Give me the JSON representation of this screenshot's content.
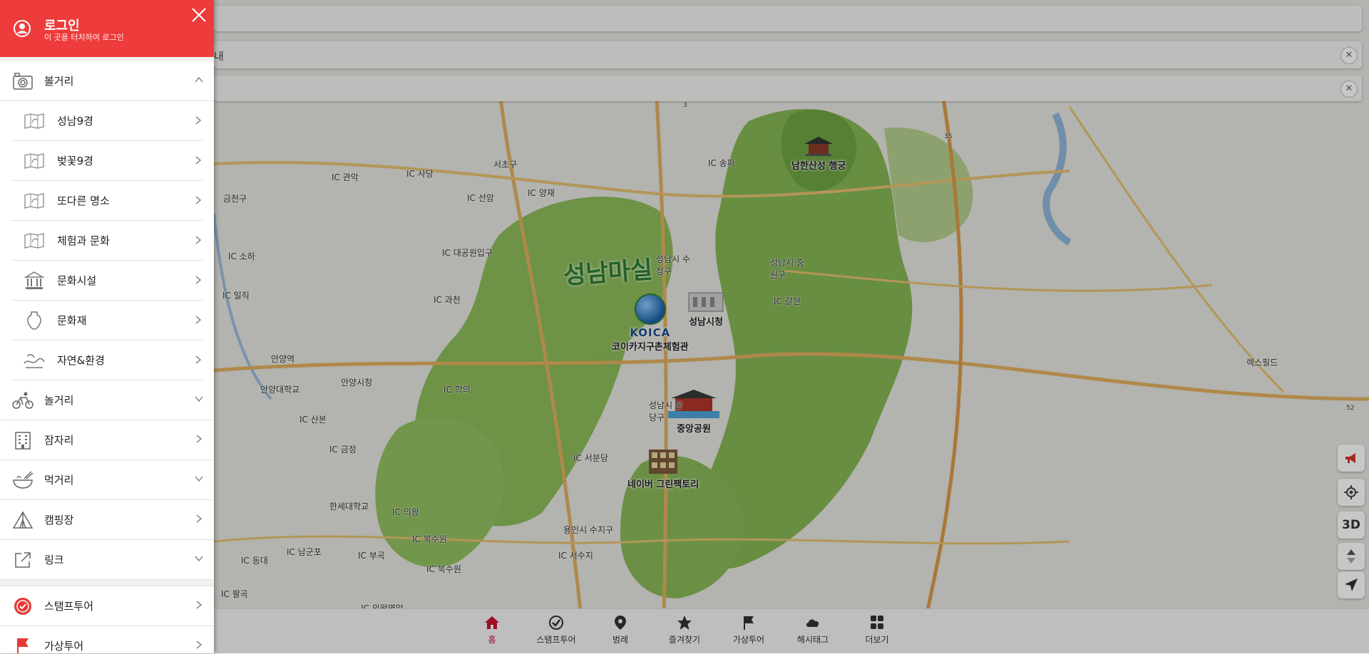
{
  "sidebar": {
    "login": {
      "title": "로그인",
      "subtitle": "이 곳을 터치하여 로그인"
    },
    "sights": {
      "label": "볼거리",
      "items": [
        {
          "label": "성남9경",
          "icon": "map-icon"
        },
        {
          "label": "벚꽃9경",
          "icon": "map-icon"
        },
        {
          "label": "또다른 명소",
          "icon": "map-icon"
        },
        {
          "label": "체험과 문화",
          "icon": "map-icon"
        },
        {
          "label": "문화시설",
          "icon": "museum-icon"
        },
        {
          "label": "문화재",
          "icon": "vase-icon"
        },
        {
          "label": "자연&환경",
          "icon": "nature-icon"
        }
      ]
    },
    "menu": [
      {
        "label": "놀거리",
        "icon": "bike-icon",
        "chevron": "down"
      },
      {
        "label": "잠자리",
        "icon": "hotel-icon",
        "chevron": "right"
      },
      {
        "label": "먹거리",
        "icon": "food-icon",
        "chevron": "down"
      },
      {
        "label": "캠핑장",
        "icon": "tent-icon",
        "chevron": "right"
      },
      {
        "label": "링크",
        "icon": "external-link-icon",
        "chevron": "down"
      }
    ],
    "extra": [
      {
        "label": "스탬프투어",
        "icon": "stamp-icon"
      },
      {
        "label": "가상투어",
        "icon": "flag-icon"
      }
    ]
  },
  "map": {
    "top_search_partial": "내",
    "logo_text": "성남마실",
    "koica_text": "KOICA",
    "pois": [
      {
        "name": "남한산성 행궁"
      },
      {
        "name": "성남시청"
      },
      {
        "name": "코이카지구촌체험관"
      },
      {
        "name": "중앙공원"
      },
      {
        "name": "네이버 그린팩토리"
      }
    ],
    "labels": [
      "서초구",
      "IC 관악",
      "IC 사당",
      "IC 선암",
      "IC 양재",
      "IC 송파",
      "금천구",
      "IC 소하",
      "IC 대공원입구",
      "IC 과천",
      "IC 일직",
      "안양역",
      "안양대학교",
      "안양시청",
      "IC 학의",
      "IC 산본",
      "IC 금정",
      "IC 서분당",
      "한세대학교",
      "IC 의왕",
      "IC 북수원",
      "IC 남군포",
      "IC 부곡",
      "IC 서수지",
      "IC 동대",
      "IC 북수원",
      "IC 팔곡",
      "IC 의왕영업",
      "IC 갈현",
      "성남시 중원구",
      "성남시 수정구",
      "성남시 분당구",
      "용인시 수지구",
      "렉스필드",
      "35",
      "52",
      "3"
    ],
    "three_d_label": "3D"
  },
  "bottom_nav": [
    {
      "label": "홈",
      "icon": "home-icon",
      "active": true
    },
    {
      "label": "스탬프투어",
      "icon": "stamp-check-icon",
      "active": false
    },
    {
      "label": "범례",
      "icon": "pin-icon",
      "active": false
    },
    {
      "label": "즐겨찾기",
      "icon": "star-icon",
      "active": false
    },
    {
      "label": "가상투어",
      "icon": "flag-icon",
      "active": false
    },
    {
      "label": "해시태그",
      "icon": "cloud-icon",
      "active": false
    },
    {
      "label": "더보기",
      "icon": "grid-icon",
      "active": false
    }
  ],
  "colors": {
    "accent": "#ee3b3b",
    "active_nav": "#c8102e",
    "forest": "#7fb24e"
  }
}
